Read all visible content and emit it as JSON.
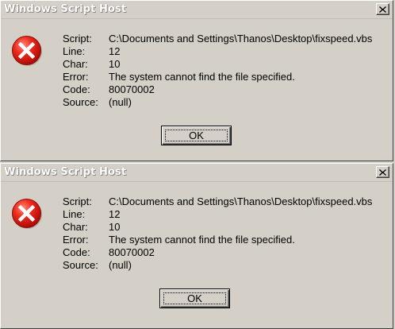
{
  "dialogs": [
    {
      "title": "Windows Script Host",
      "close_glyph": "×",
      "icon": "error-icon",
      "fields": [
        {
          "label": "Script:",
          "value": "C:\\Documents and Settings\\Thanos\\Desktop\\fixspeed.vbs"
        },
        {
          "label": "Line:",
          "value": "12"
        },
        {
          "label": "Char:",
          "value": "10"
        },
        {
          "label": "Error:",
          "value": "The system cannot find the file specified."
        },
        {
          "label": "Code:",
          "value": "80070002"
        },
        {
          "label": "Source:",
          "value": "(null)"
        }
      ],
      "ok_label": "OK"
    },
    {
      "title": "Windows Script Host",
      "close_glyph": "×",
      "icon": "error-icon",
      "fields": [
        {
          "label": "Script:",
          "value": "C:\\Documents and Settings\\Thanos\\Desktop\\fixspeed.vbs"
        },
        {
          "label": "Line:",
          "value": "12"
        },
        {
          "label": "Char:",
          "value": "10"
        },
        {
          "label": "Error:",
          "value": "The system cannot find the file specified."
        },
        {
          "label": "Code:",
          "value": "80070002"
        },
        {
          "label": "Source:",
          "value": "(null)"
        }
      ],
      "ok_label": "OK"
    }
  ],
  "colors": {
    "dialog_face": "#d4d0c8",
    "error_red": "#e81818",
    "title_text": "#ffffff"
  }
}
